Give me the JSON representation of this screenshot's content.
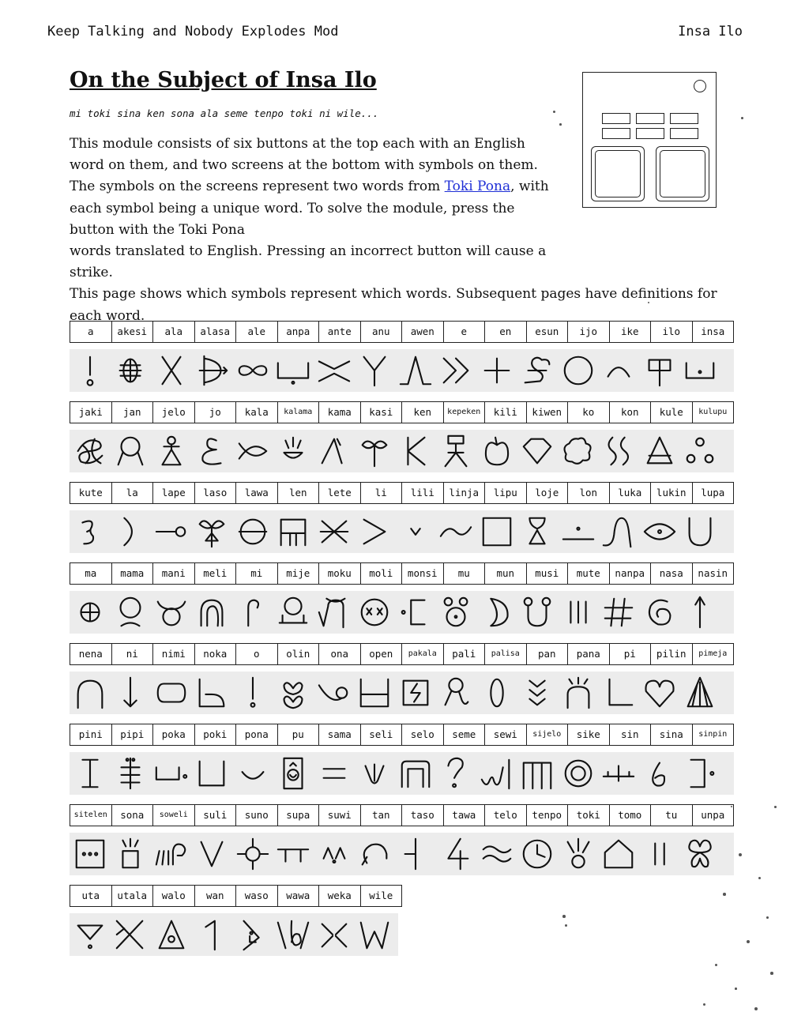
{
  "header": {
    "left": "Keep Talking and Nobody Explodes Mod",
    "right": "Insa Ilo"
  },
  "title": "On the Subject of Insa Ilo",
  "subtitle": "mi toki sina ken sona ala seme tenpo toki ni wile...",
  "intro": {
    "text1": "This module consists of six buttons at the top each with an English word on them, and two screens at the bottom with symbols on them. The symbols on the screens represent two words from ",
    "link": "Toki Pona",
    "text2": ", with each symbol being a unique word. To solve the module, press the button with the Toki Pona",
    "text3": "words translated to English. Pressing an incorrect button will cause a strike.",
    "text4": "This page shows which symbols represent which words. Subsequent pages have definitions for each word."
  },
  "rows": [
    [
      "a",
      "akesi",
      "ala",
      "alasa",
      "ale",
      "anpa",
      "ante",
      "anu",
      "awen",
      "e",
      "en",
      "esun",
      "ijo",
      "ike",
      "ilo",
      "insa"
    ],
    [
      "jaki",
      "jan",
      "jelo",
      "jo",
      "kala",
      "kalama",
      "kama",
      "kasi",
      "ken",
      "kepeken",
      "kili",
      "kiwen",
      "ko",
      "kon",
      "kule",
      "kulupu"
    ],
    [
      "kute",
      "la",
      "lape",
      "laso",
      "lawa",
      "len",
      "lete",
      "li",
      "lili",
      "linja",
      "lipu",
      "loje",
      "lon",
      "luka",
      "lukin",
      "lupa"
    ],
    [
      "ma",
      "mama",
      "mani",
      "meli",
      "mi",
      "mije",
      "moku",
      "moli",
      "monsi",
      "mu",
      "mun",
      "musi",
      "mute",
      "nanpa",
      "nasa",
      "nasin"
    ],
    [
      "nena",
      "ni",
      "nimi",
      "noka",
      "o",
      "olin",
      "ona",
      "open",
      "pakala",
      "pali",
      "palisa",
      "pan",
      "pana",
      "pi",
      "pilin",
      "pimeja"
    ],
    [
      "pini",
      "pipi",
      "poka",
      "poki",
      "pona",
      "pu",
      "sama",
      "seli",
      "selo",
      "seme",
      "sewi",
      "sijelo",
      "sike",
      "sin",
      "sina",
      "sinpin"
    ],
    [
      "sitelen",
      "sona",
      "soweli",
      "suli",
      "suno",
      "supa",
      "suwi",
      "tan",
      "taso",
      "tawa",
      "telo",
      "tenpo",
      "toki",
      "tomo",
      "tu",
      "unpa"
    ],
    [
      "uta",
      "utala",
      "walo",
      "wan",
      "waso",
      "wawa",
      "weka",
      "wile"
    ]
  ]
}
